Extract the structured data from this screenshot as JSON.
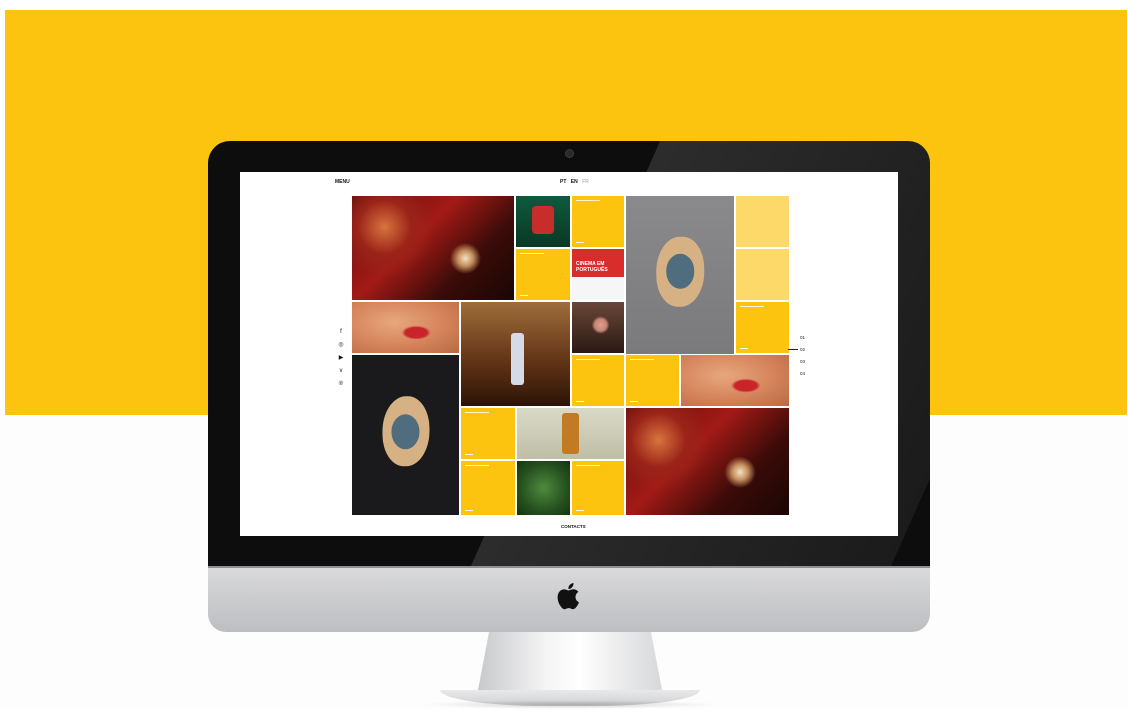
{
  "site": {
    "menu_label": "MENU",
    "languages": [
      "PT",
      "EN",
      "FR"
    ],
    "footer_link": "CONTACTS",
    "pager": [
      "01",
      "02",
      "03",
      "04"
    ],
    "social_icons": [
      {
        "name": "facebook-icon",
        "glyph": "f"
      },
      {
        "name": "instagram-icon",
        "glyph": "◎"
      },
      {
        "name": "youtube-icon",
        "glyph": "▶"
      },
      {
        "name": "vimeo-icon",
        "glyph": "v"
      },
      {
        "name": "pinterest-icon",
        "glyph": "℗"
      }
    ]
  },
  "tiles": {
    "poster_cinema_title": "CINEMA EM PORTUGUÊS",
    "accent_color": "#fdc40f"
  },
  "colors": {
    "background_top": "#fdc40f",
    "background_bottom": "#fdfdfd",
    "bezel": "#0d0d0d"
  }
}
